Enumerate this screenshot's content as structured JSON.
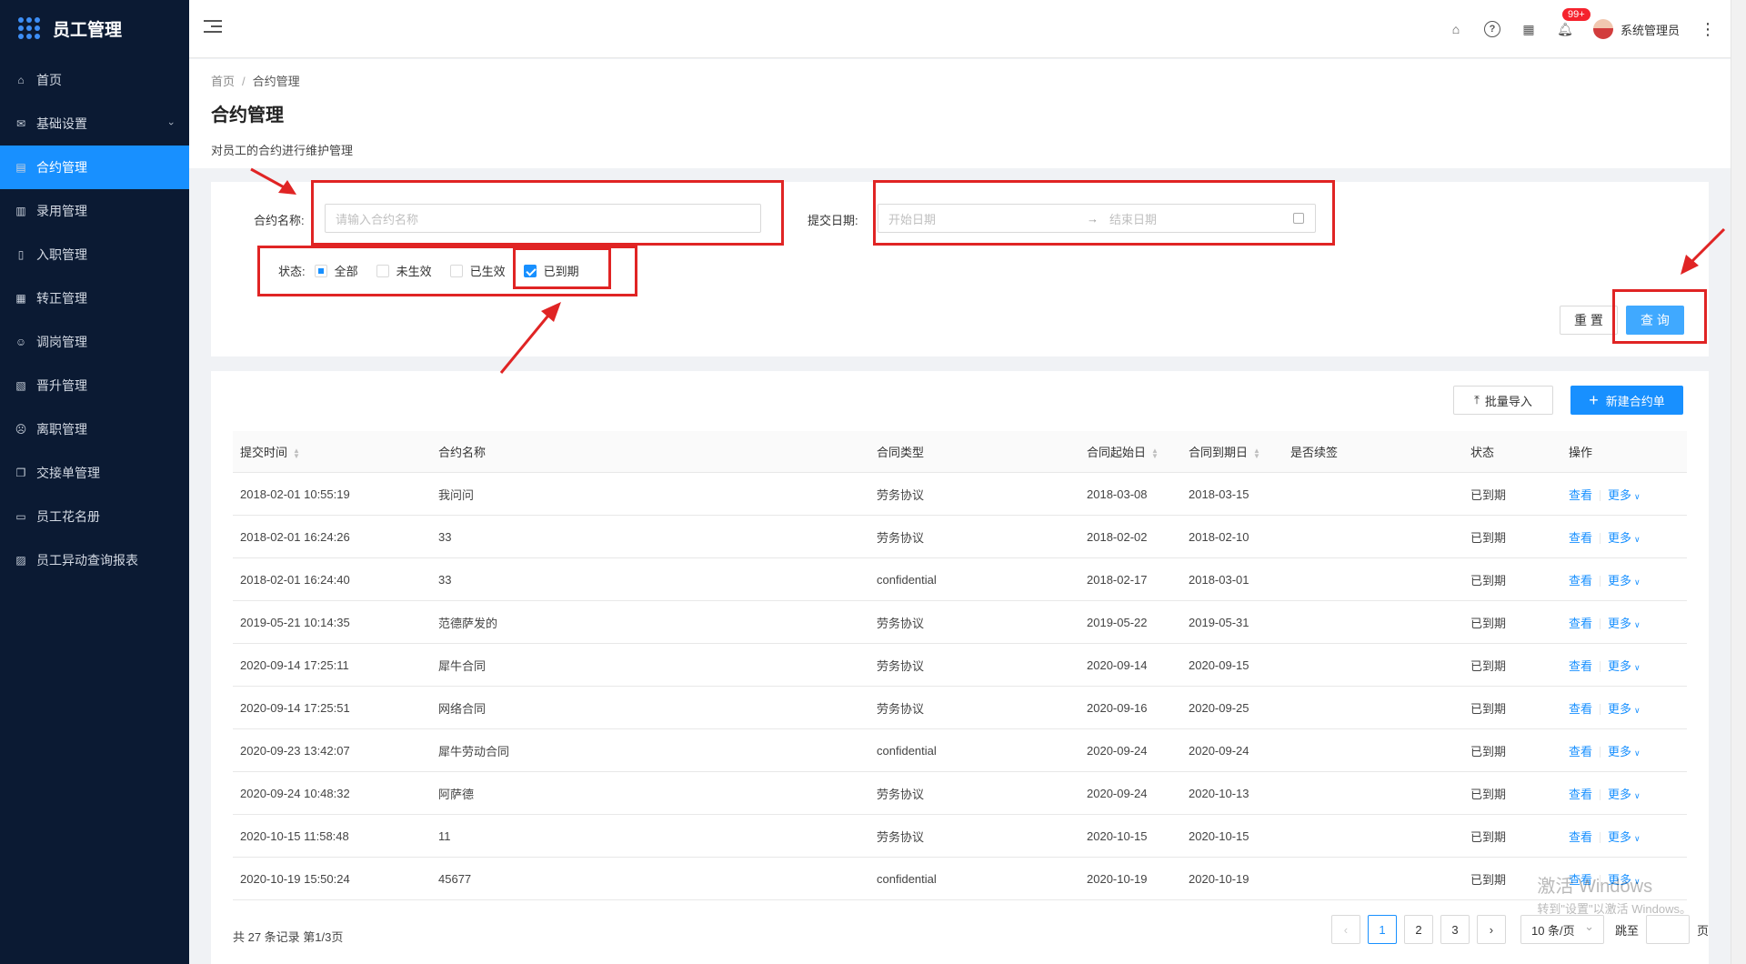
{
  "app": {
    "title": "员工管理"
  },
  "sidebar": {
    "items": [
      {
        "label": "首页",
        "icon": "home-icon"
      },
      {
        "label": "基础设置",
        "icon": "mail-icon"
      },
      {
        "label": "合约管理",
        "icon": "calendar-icon"
      },
      {
        "label": "录用管理",
        "icon": "table-icon"
      },
      {
        "label": "入职管理",
        "icon": "book-icon"
      },
      {
        "label": "转正管理",
        "icon": "grid-icon"
      },
      {
        "label": "调岗管理",
        "icon": "user-icon"
      },
      {
        "label": "晋升管理",
        "icon": "file-icon"
      },
      {
        "label": "离职管理",
        "icon": "user-remove-icon"
      },
      {
        "label": "交接单管理",
        "icon": "copy-icon"
      },
      {
        "label": "员工花名册",
        "icon": "idcard-icon"
      },
      {
        "label": "员工异动查询报表",
        "icon": "report-icon"
      }
    ]
  },
  "header": {
    "badge": "99+",
    "user": "系统管理员"
  },
  "breadcrumb": {
    "home": "首页",
    "current": "合约管理"
  },
  "page": {
    "title": "合约管理",
    "description": "对员工的合约进行维护管理"
  },
  "filter": {
    "name_label": "合约名称:",
    "name_placeholder": "请输入合约名称",
    "date_label": "提交日期:",
    "start_placeholder": "开始日期",
    "end_placeholder": "结束日期",
    "status_label": "状态:",
    "status_options": [
      "全部",
      "未生效",
      "已生效",
      "已到期"
    ],
    "reset": "重 置",
    "query": "查 询"
  },
  "toolbar": {
    "import": "批量导入",
    "create": "新建合约单"
  },
  "table": {
    "columns": [
      "提交时间",
      "合约名称",
      "合同类型",
      "合同起始日",
      "合同到期日",
      "是否续签",
      "状态",
      "操作"
    ],
    "view_label": "查看",
    "more_label": "更多",
    "rows": [
      [
        "2018-02-01 10:55:19",
        "我问问",
        "劳务协议",
        "2018-03-08",
        "2018-03-15",
        "",
        "已到期"
      ],
      [
        "2018-02-01 16:24:26",
        "33",
        "劳务协议",
        "2018-02-02",
        "2018-02-10",
        "",
        "已到期"
      ],
      [
        "2018-02-01 16:24:40",
        "33",
        "confidential",
        "2018-02-17",
        "2018-03-01",
        "",
        "已到期"
      ],
      [
        "2019-05-21 10:14:35",
        "范德萨发的",
        "劳务协议",
        "2019-05-22",
        "2019-05-31",
        "",
        "已到期"
      ],
      [
        "2020-09-14 17:25:11",
        "犀牛合同",
        "劳务协议",
        "2020-09-14",
        "2020-09-15",
        "",
        "已到期"
      ],
      [
        "2020-09-14 17:25:51",
        "网络合同",
        "劳务协议",
        "2020-09-16",
        "2020-09-25",
        "",
        "已到期"
      ],
      [
        "2020-09-23 13:42:07",
        "犀牛劳动合同",
        "confidential",
        "2020-09-24",
        "2020-09-24",
        "",
        "已到期"
      ],
      [
        "2020-09-24 10:48:32",
        "阿萨德",
        "劳务协议",
        "2020-09-24",
        "2020-10-13",
        "",
        "已到期"
      ],
      [
        "2020-10-15 11:58:48",
        "11",
        "劳务协议",
        "2020-10-15",
        "2020-10-15",
        "",
        "已到期"
      ],
      [
        "2020-10-19 15:50:24",
        "45677",
        "confidential",
        "2020-10-19",
        "2020-10-19",
        "",
        "已到期"
      ]
    ]
  },
  "pagination": {
    "total": "共 27 条记录 第1/3页",
    "pages": [
      "1",
      "2",
      "3"
    ],
    "page_size": "10 条/页",
    "jump_label": "跳至",
    "page_unit": "页"
  },
  "watermark": {
    "line1": "激活 Windows",
    "line2": "转到\"设置\"以激活 Windows。"
  },
  "colors": {
    "sidebar": "#0b1a33",
    "primary": "#1890ff",
    "annotation": "#e02424"
  }
}
